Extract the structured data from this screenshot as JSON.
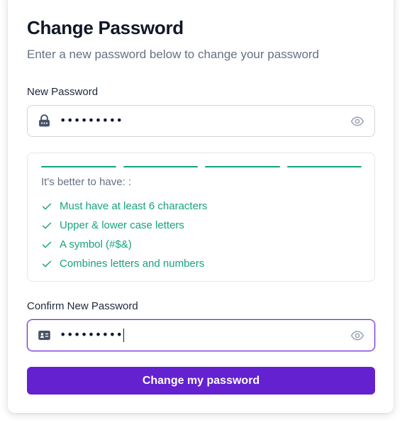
{
  "header": {
    "title": "Change Password",
    "subtitle": "Enter a new password below to change your password"
  },
  "new_password": {
    "label": "New Password",
    "value": "•••••••••",
    "leading_icon": "lock-icon",
    "trailing_icon": "eye-icon"
  },
  "strength": {
    "segments_total": 4,
    "segments_filled": 4,
    "color": "#16a37e",
    "hint_title": "It's better to have: :",
    "requirements": [
      {
        "label": "Must have at least 6 characters",
        "met": true
      },
      {
        "label": "Upper & lower case letters",
        "met": true
      },
      {
        "label": "A symbol (#$&)",
        "met": true
      },
      {
        "label": "Combines letters and numbers",
        "met": true
      }
    ]
  },
  "confirm_password": {
    "label": "Confirm New Password",
    "value": "•••••••••",
    "leading_icon": "id-card-icon",
    "trailing_icon": "eye-icon",
    "focused": true
  },
  "submit": {
    "label": "Change my password",
    "color": "#6321cf"
  }
}
